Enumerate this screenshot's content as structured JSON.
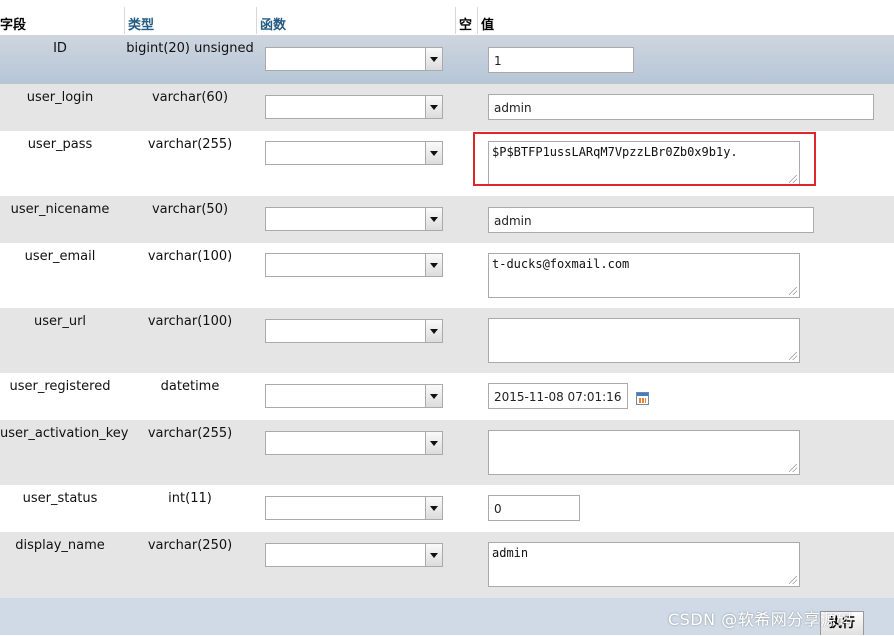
{
  "header": {
    "field": "字段",
    "type": "类型",
    "function": "函数",
    "null": "空",
    "value": "值"
  },
  "rows": [
    {
      "name": "ID",
      "type": "bigint(20) unsigned",
      "value": "1"
    },
    {
      "name": "user_login",
      "type": "varchar(60)",
      "value": "admin"
    },
    {
      "name": "user_pass",
      "type": "varchar(255)",
      "value": "$P$BTFP1ussLARqM7VpzzLBr0Zb0x9b1y."
    },
    {
      "name": "user_nicename",
      "type": "varchar(50)",
      "value": "admin"
    },
    {
      "name": "user_email",
      "type": "varchar(100)",
      "value": "t-ducks@foxmail.com"
    },
    {
      "name": "user_url",
      "type": "varchar(100)",
      "value": ""
    },
    {
      "name": "user_registered",
      "type": "datetime",
      "value": "2015-11-08 07:01:16"
    },
    {
      "name": "user_activation_key",
      "type": "varchar(255)",
      "value": ""
    },
    {
      "name": "user_status",
      "type": "int(11)",
      "value": "0"
    },
    {
      "name": "display_name",
      "type": "varchar(250)",
      "value": "admin"
    }
  ],
  "footer": {
    "exec_label": "执行",
    "watermark": "CSDN @软希网分享源码"
  },
  "colors": {
    "highlight_border": "#e0262b",
    "header_link": "#235a81",
    "row_gray": "#e5e5e5"
  },
  "icons": {
    "calendar": "calendar-icon",
    "dropdown": "chevron-down-icon",
    "resize": "resize-grip-icon"
  }
}
